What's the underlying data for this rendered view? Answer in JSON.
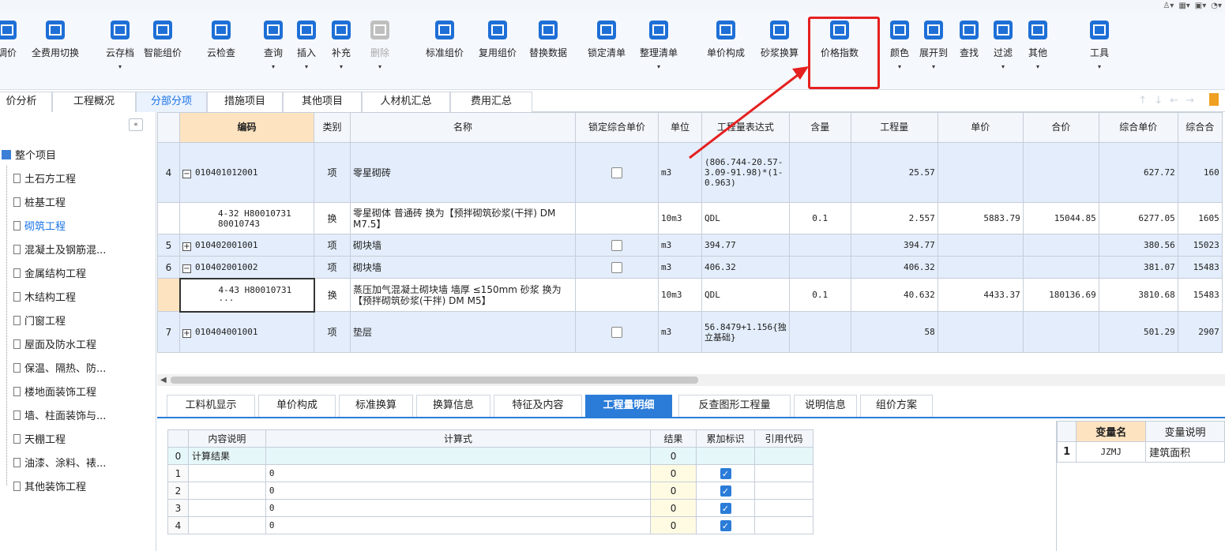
{
  "toolbar": {
    "buttons": [
      {
        "label": "调价",
        "icon": "adjust-price-icon"
      },
      {
        "label": "全费用切换",
        "icon": "full-cost-switch-icon"
      },
      {
        "label": "云存档",
        "icon": "cloud-archive-icon"
      },
      {
        "label": "智能组价",
        "icon": "smart-pricing-icon"
      },
      {
        "label": "云检查",
        "icon": "cloud-check-icon"
      },
      {
        "label": "查询",
        "icon": "query-icon"
      },
      {
        "label": "插入",
        "icon": "insert-icon"
      },
      {
        "label": "补充",
        "icon": "supplement-icon"
      },
      {
        "label": "删除",
        "icon": "delete-icon"
      },
      {
        "label": "标准组价",
        "icon": "standard-pricing-icon"
      },
      {
        "label": "复用组价",
        "icon": "reuse-pricing-icon"
      },
      {
        "label": "替换数据",
        "icon": "replace-data-icon"
      },
      {
        "label": "锁定清单",
        "icon": "lock-list-icon"
      },
      {
        "label": "整理清单",
        "icon": "organize-list-icon"
      },
      {
        "label": "单价构成",
        "icon": "unit-price-composition-icon"
      },
      {
        "label": "砂浆换算",
        "icon": "mortar-conversion-icon"
      },
      {
        "label": "价格指数",
        "icon": "price-index-icon"
      },
      {
        "label": "颜色",
        "icon": "color-icon"
      },
      {
        "label": "展开到",
        "icon": "expand-to-icon"
      },
      {
        "label": "查找",
        "icon": "find-icon"
      },
      {
        "label": "过滤",
        "icon": "filter-icon"
      },
      {
        "label": "其他",
        "icon": "other-icon"
      },
      {
        "label": "工具",
        "icon": "tools-icon"
      }
    ]
  },
  "tabs": [
    "价分析",
    "工程概况",
    "分部分项",
    "措施项目",
    "其他项目",
    "人材机汇总",
    "费用汇总"
  ],
  "tree": {
    "root": "整个项目",
    "items": [
      "土石方工程",
      "桩基工程",
      "砌筑工程",
      "混凝土及钢筋混...",
      "金属结构工程",
      "木结构工程",
      "门窗工程",
      "屋面及防水工程",
      "保温、隔热、防...",
      "楼地面装饰工程",
      "墙、柱面装饰与...",
      "天棚工程",
      "油漆、涂料、裱...",
      "其他装饰工程"
    ]
  },
  "grid": {
    "headers": [
      "编码",
      "类别",
      "名称",
      "锁定综合单价",
      "单位",
      "工程量表达式",
      "含量",
      "工程量",
      "单价",
      "合价",
      "综合单价",
      "综合合"
    ],
    "rows": [
      {
        "no": "4",
        "code": "010401012001",
        "expand": "−",
        "type": "项",
        "name": "零星砌砖",
        "lock": false,
        "unit": "m3",
        "expr": "(806.744-20.57-3.09-91.98)*(1-0.963)",
        "content": "",
        "qty": "25.57",
        "price": "",
        "total": "",
        "uprice": "627.72",
        "utotal": "160"
      },
      {
        "no": "",
        "code": "4-32 H80010731 80010743",
        "type": "换",
        "name": "零星砌体 普通砖  换为【预拌砌筑砂浆(干拌) DM M7.5】",
        "unit": "10m3",
        "expr": "QDL",
        "content": "0.1",
        "qty": "2.557",
        "price": "5883.79",
        "total": "15044.85",
        "uprice": "6277.05",
        "utotal": "1605"
      },
      {
        "no": "5",
        "code": "010402001001",
        "expand": "+",
        "type": "项",
        "name": "砌块墙",
        "lock": false,
        "unit": "m3",
        "expr": "394.77",
        "content": "",
        "qty": "394.77",
        "price": "",
        "total": "",
        "uprice": "380.56",
        "utotal": "15023"
      },
      {
        "no": "6",
        "code": "010402001002",
        "expand": "−",
        "type": "项",
        "name": "砌块墙",
        "lock": false,
        "unit": "m3",
        "expr": "406.32",
        "content": "",
        "qty": "406.32",
        "price": "",
        "total": "",
        "uprice": "381.07",
        "utotal": "15483"
      },
      {
        "no": "",
        "code": "4-43 H80010731 ···",
        "type": "换",
        "name": "蒸压加气混凝土砌块墙 墙厚 ≤150mm 砂浆  换为【预拌砌筑砂浆(干拌) DM M5】",
        "unit": "10m3",
        "expr": "QDL",
        "content": "0.1",
        "qty": "40.632",
        "price": "4433.37",
        "total": "180136.69",
        "uprice": "3810.68",
        "utotal": "15483"
      },
      {
        "no": "7",
        "code": "010404001001",
        "expand": "+",
        "type": "项",
        "name": "垫层",
        "lock": false,
        "unit": "m3",
        "expr": "56.8479+1.156{独立基础}",
        "content": "",
        "qty": "58",
        "price": "",
        "total": "",
        "uprice": "501.29",
        "utotal": "2907"
      }
    ]
  },
  "bottom_tabs": [
    "工料机显示",
    "单价构成",
    "标准换算",
    "换算信息",
    "特征及内容",
    "工程量明细",
    "反查图形工程量",
    "说明信息",
    "组价方案"
  ],
  "detail": {
    "headers": [
      "内容说明",
      "计算式",
      "结果",
      "累加标识",
      "引用代码"
    ],
    "rows": [
      {
        "idx": "0",
        "desc": "计算结果",
        "formula": "",
        "result": "0",
        "acc": false
      },
      {
        "idx": "1",
        "desc": "",
        "formula": "0",
        "result": "0",
        "acc": true
      },
      {
        "idx": "2",
        "desc": "",
        "formula": "0",
        "result": "0",
        "acc": true
      },
      {
        "idx": "3",
        "desc": "",
        "formula": "0",
        "result": "0",
        "acc": true
      },
      {
        "idx": "4",
        "desc": "",
        "formula": "0",
        "result": "0",
        "acc": true
      }
    ]
  },
  "variables": {
    "headers": [
      "变量名",
      "变量说明"
    ],
    "rows": [
      {
        "idx": "1",
        "name": "JZMJ",
        "desc": "建筑面积"
      }
    ]
  },
  "colors": {
    "accent": "#2b7cd8",
    "highlight": "#e52020",
    "row_bg": "#e3edfb",
    "header_code": "#fde3c0"
  }
}
